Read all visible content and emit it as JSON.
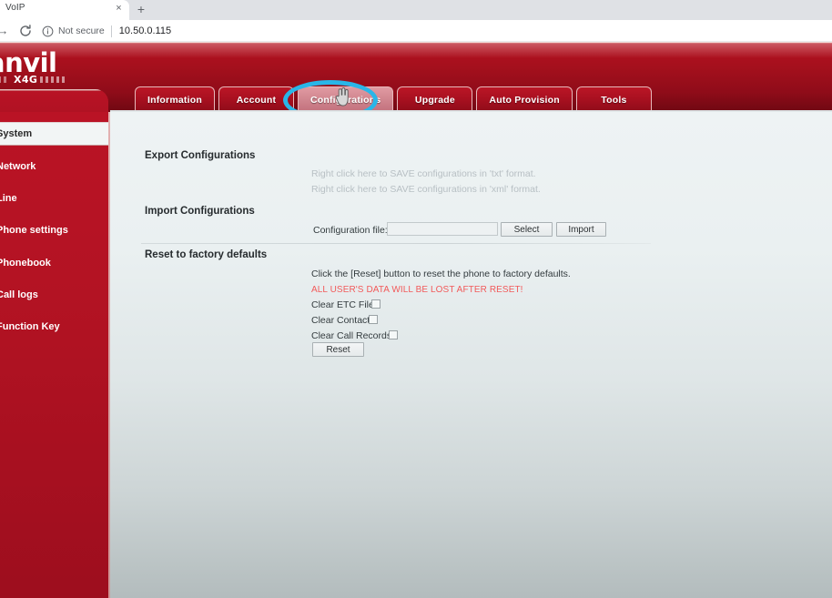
{
  "browser": {
    "tab_title": "VoIP",
    "close_label": "×",
    "newtab_label": "+",
    "forward_label": "→",
    "security_label": "Not secure",
    "url": "10.50.0.115"
  },
  "brand": {
    "name": "anvil",
    "model": "X4G"
  },
  "tabs": [
    {
      "label": "Information",
      "active": false
    },
    {
      "label": "Account",
      "active": false
    },
    {
      "label": "Configurations",
      "active": true
    },
    {
      "label": "Upgrade",
      "active": false
    },
    {
      "label": "Auto Provision",
      "active": false
    },
    {
      "label": "Tools",
      "active": false
    }
  ],
  "sidebar": {
    "items": [
      {
        "label": "System",
        "active": true
      },
      {
        "label": "Network",
        "active": false
      },
      {
        "label": "Line",
        "active": false
      },
      {
        "label": "Phone settings",
        "active": false
      },
      {
        "label": "Phonebook",
        "active": false
      },
      {
        "label": "Call logs",
        "active": false
      },
      {
        "label": "Function Key",
        "active": false
      }
    ]
  },
  "main": {
    "export": {
      "title": "Export Configurations",
      "link_txt": "Right click here to SAVE configurations in 'txt' format.",
      "link_xml": "Right click here to SAVE configurations in 'xml' format."
    },
    "import": {
      "title": "Import Configurations",
      "file_label": "Configuration file:",
      "file_value": "",
      "select_button": "Select",
      "import_button": "Import"
    },
    "reset": {
      "title": "Reset to factory defaults",
      "instruction": "Click the [Reset] button to reset the phone to factory defaults.",
      "warning": "ALL USER'S DATA WILL BE LOST AFTER RESET!",
      "checkboxes": [
        {
          "label": "Clear ETC File",
          "checked": false
        },
        {
          "label": "Clear Contact",
          "checked": false
        },
        {
          "label": "Clear Call Records",
          "checked": false
        }
      ],
      "reset_button": "Reset"
    }
  },
  "colors": {
    "brand_red": "#b31323",
    "highlight_cyan": "#29b6e8",
    "warning_red": "#f25a5a"
  }
}
